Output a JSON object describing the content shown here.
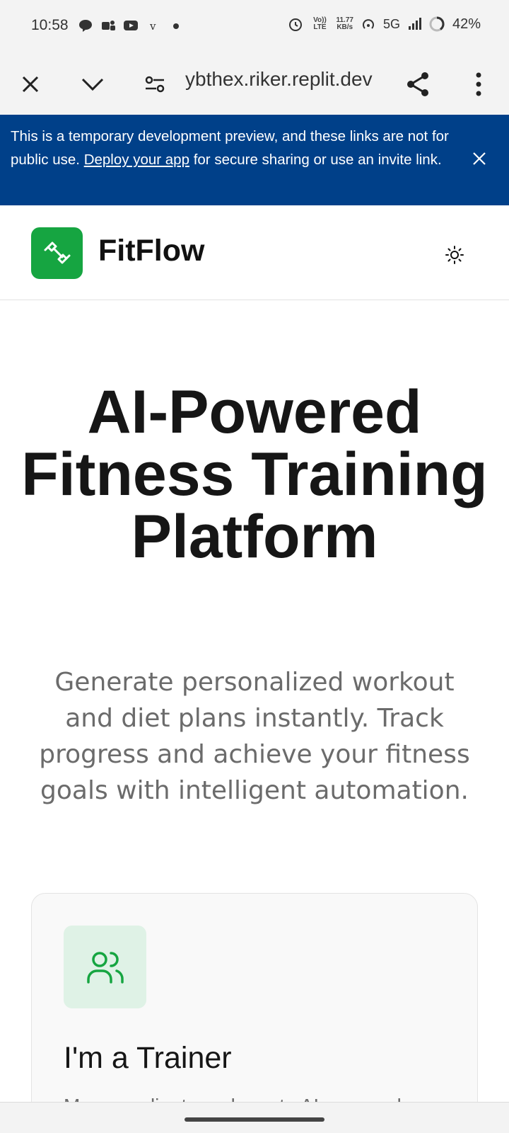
{
  "status_bar": {
    "time": "10:58",
    "network_speed": "11.77",
    "speed_unit": "KB/s",
    "volte": "Vo)) LTE",
    "network_type": "5G",
    "battery": "42%",
    "left_icons": [
      "chat-icon",
      "teams-icon",
      "youtube-icon",
      "v-icon",
      "dot-icon"
    ]
  },
  "browser": {
    "url": "ybthex.riker.replit.dev"
  },
  "banner": {
    "text_before": "This is a temporary development preview, and these links are not for public use. ",
    "link_text": "Deploy your app",
    "text_after": " for secure sharing or use an invite link.",
    "bg_color": "#004089"
  },
  "header": {
    "brand": "FitFlow",
    "accent_color": "#16a541"
  },
  "hero": {
    "title": "AI-Powered Fitness Training Platform",
    "subtitle": "Generate personalized workout and diet plans instantly. Track progress and achieve your fitness goals with intelligent automation."
  },
  "card": {
    "title": "I'm a Trainer",
    "description": "Manage clients and create AI-powered"
  }
}
